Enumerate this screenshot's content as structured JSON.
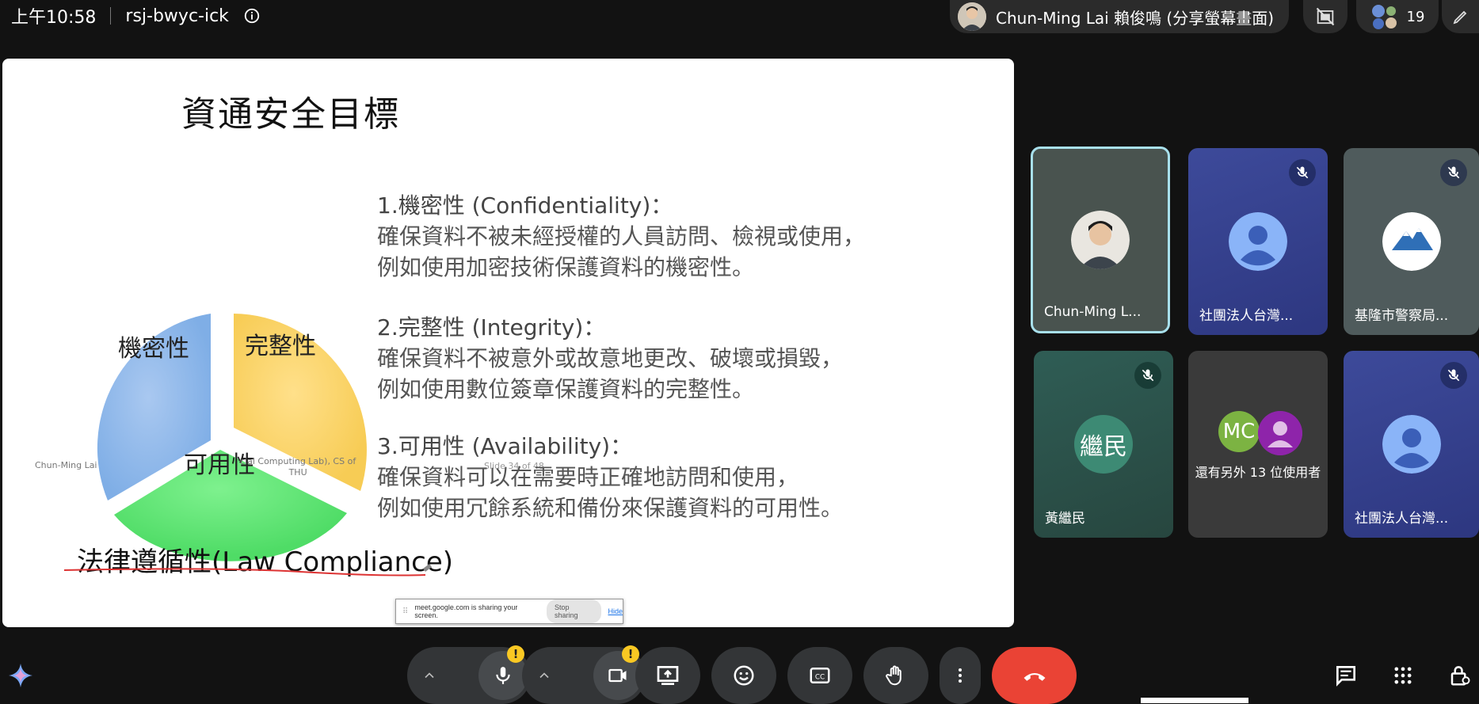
{
  "topbar": {
    "time": "上午10:58",
    "meeting_code": "rsj-bwyc-ick",
    "presenter_label": "Chun-Ming Lai 賴俊鳴 (分享螢幕畫面)",
    "participant_count": "19"
  },
  "slide": {
    "title": "資通安全目標",
    "pie_labels": [
      "機密性",
      "完整性",
      "可用性"
    ],
    "author": "Chun-Ming Lai",
    "lab_text_line1": "cial Computing Lab), CS of",
    "lab_text_line2": "THU",
    "slide_counter": "Slide 34 of 48",
    "items": [
      {
        "head": "1.機密性 (Confidentiality)：",
        "line1": "確保資料不被未經授權的人員訪問、檢視或使用，",
        "line2": "例如使用加密技術保護資料的機密性。"
      },
      {
        "head": "2.完整性 (Integrity)：",
        "line1": "確保資料不被意外或故意地更改、破壞或損毀，",
        "line2": "例如使用數位簽章保護資料的完整性。"
      },
      {
        "head": "3.可用性 (Availability)：",
        "line1": "確保資料可以在需要時正確地訪問和使用，",
        "line2": "例如使用冗餘系統和備份來保護資料的可用性。"
      }
    ],
    "law_compliance": "法律遵循性(Law Compliance)"
  },
  "share_notice": {
    "text": "meet.google.com is sharing your screen.",
    "stop_label": "Stop sharing",
    "hide_label": "Hide"
  },
  "tiles": [
    {
      "name": "Chun-Ming L...",
      "muted": false
    },
    {
      "name": "社團法人台灣...",
      "muted": true
    },
    {
      "name": "基隆市警察局...",
      "muted": true
    },
    {
      "name": "黃繼民",
      "initials": "繼民",
      "muted": true
    },
    {
      "initials": "MC",
      "more_text": "還有另外 13 位使用者"
    },
    {
      "name": "社團法人台灣...",
      "muted": true
    }
  ],
  "colors": {
    "accent_end_call": "#ea4335",
    "active_speaker_border": "#a8e0ec",
    "warning": "#f9c823"
  },
  "icons": [
    "info-icon",
    "camera-off-icon",
    "pen-icon",
    "mic-icon",
    "camera-icon",
    "present-icon",
    "emoji-icon",
    "captions-icon",
    "hand-icon",
    "more-vert-icon",
    "end-call-icon",
    "chat-icon",
    "apps-icon",
    "host-lock-icon",
    "gemini-icon"
  ]
}
